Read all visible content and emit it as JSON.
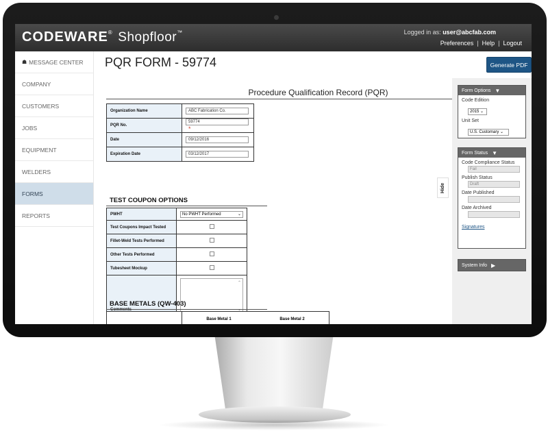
{
  "app": {
    "brand": "CODEWARE",
    "brand_product": "Shopfloor",
    "user_label": "Logged in as:",
    "user_name": "user@abcfab.com",
    "links": [
      "Preferences",
      "Help",
      "Logout"
    ]
  },
  "sidebar": {
    "items": [
      {
        "label": "MESSAGE CENTER"
      },
      {
        "label": "COMPANY"
      },
      {
        "label": "CUSTOMERS"
      },
      {
        "label": "JOBS"
      },
      {
        "label": "EQUIPMENT"
      },
      {
        "label": "WELDERS"
      },
      {
        "label": "FORMS"
      },
      {
        "label": "REPORTS"
      }
    ],
    "active": "FORMS"
  },
  "page": {
    "title": "PQR FORM - 59774",
    "generate_pdf": "Generate PDF",
    "form_title": "Procedure Qualification Record (PQR)",
    "hide_tab": "Hide"
  },
  "header_fields": {
    "org_label": "Organization Name",
    "org_value": "ABC Fabrication Co.",
    "pqr_label": "PQR No.",
    "pqr_value": "59774",
    "date_label": "Date",
    "date_value": "09/12/2016",
    "exp_label": "Expiration Date",
    "exp_value": "03/12/2017"
  },
  "test_coupon": {
    "heading": "TEST COUPON OPTIONS",
    "pwht_label": "PWHT",
    "pwht_value": "No PWHT Performed",
    "impact_label": "Test Coupons Impact Tested",
    "fillet_label": "Fillet-Weld Tests Performed",
    "other_label": "Other Tests Performed",
    "tubesheet_label": "Tubesheet Mockup",
    "comments_label": "Comments"
  },
  "base_metals": {
    "heading": "BASE METALS (QW-403)",
    "col1": "Base Metal 1",
    "col2": "Base Metal 2"
  },
  "form_options": {
    "title": "Form Options",
    "code_edition_label": "Code Edition",
    "code_edition_value": "2015",
    "unit_set_label": "Unit Set",
    "unit_set_value": "U.S. Customary"
  },
  "form_status": {
    "title": "Form Status",
    "compliance_label": "Code Compliance Status",
    "compliance_value": "Fail",
    "publish_label": "Publish Status",
    "publish_value": "Draft",
    "date_published_label": "Date Published",
    "date_archived_label": "Date Archived",
    "signatures_link": "Signatures"
  },
  "system_info": {
    "title": "System Info"
  },
  "colors": {
    "topbar": "#3a3a3a",
    "accent": "#1e5585",
    "sidebar_active": "#cfdde9",
    "field_label_bg": "#e9f1f8"
  }
}
